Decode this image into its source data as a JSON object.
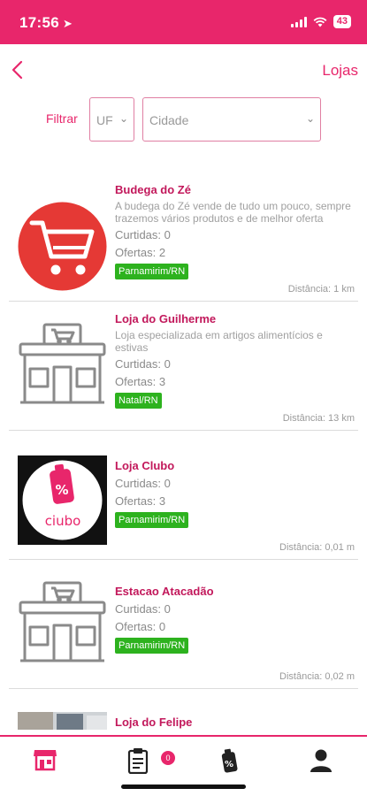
{
  "status_bar": {
    "time": "17:56",
    "battery": "43"
  },
  "header": {
    "title": "Lojas"
  },
  "filter": {
    "label": "Filtrar",
    "uf_placeholder": "UF",
    "city_placeholder": "Cidade"
  },
  "stores": [
    {
      "name": "Budega do Zé",
      "description": "A budega do Zé vende de tudo um pouco, sempre trazemos vários produtos e de melhor oferta",
      "likes": "Curtidas: 0",
      "offers": "Ofertas: 2",
      "location": "Parnamirim/RN",
      "distance": "Distância: 1 km",
      "image": "cart-icon"
    },
    {
      "name": "Loja do Guilherme",
      "description": "Loja especializada em artigos alimentícios e estivas",
      "likes": "Curtidas: 0",
      "offers": "Ofertas: 3",
      "location": "Natal/RN",
      "distance": "Distância: 13 km",
      "image": "storefront-icon"
    },
    {
      "name": "Loja Clubo",
      "description": "",
      "likes": "Curtidas: 0",
      "offers": "Ofertas: 3",
      "location": "Parnamirim/RN",
      "distance": "Distância: 0,01 m",
      "image": "clubo-logo",
      "logo_text": "ciubo"
    },
    {
      "name": "Estacao Atacadão",
      "description": "",
      "likes": "Curtidas: 0",
      "offers": "Ofertas: 0",
      "location": "Parnamirim/RN",
      "distance": "Distância: 0,02 m",
      "image": "storefront-icon"
    },
    {
      "name": "Loja do Felipe",
      "image": "store-photo"
    }
  ],
  "bottom_nav": {
    "items": [
      "stores-icon",
      "list-icon",
      "offers-icon",
      "profile-icon"
    ],
    "list_badge": "0"
  },
  "colors": {
    "primary": "#e8266b",
    "store_name": "#c2185b",
    "badge": "#2db21e"
  }
}
